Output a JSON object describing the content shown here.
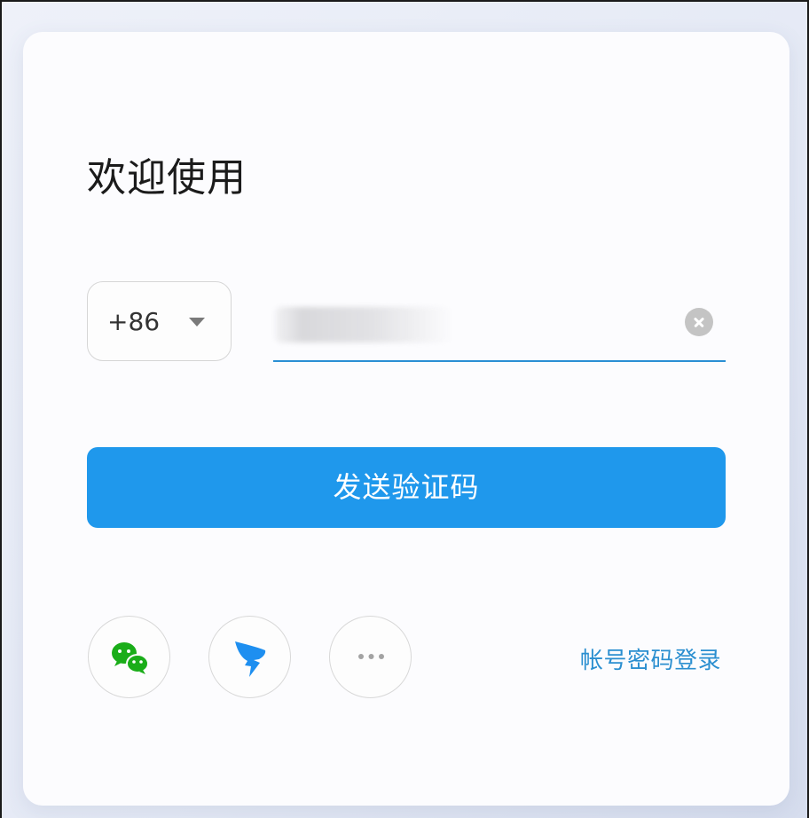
{
  "login": {
    "title": "欢迎使用",
    "country_code": "+86",
    "phone_value": "",
    "send_button_label": "发送验证码",
    "account_login_link": "帐号密码登录"
  },
  "social_logins": [
    {
      "name": "wechat",
      "icon": "wechat-icon",
      "color": "#1aad19"
    },
    {
      "name": "dingtalk",
      "icon": "dingtalk-icon",
      "color": "#1e8ff0"
    },
    {
      "name": "more",
      "icon": "more-icon",
      "color": "#9a9a9a"
    }
  ],
  "colors": {
    "accent": "#1f98ec",
    "link": "#2b8fd0",
    "input_underline": "#2a8fd4",
    "card_background": "#fcfcfe"
  }
}
